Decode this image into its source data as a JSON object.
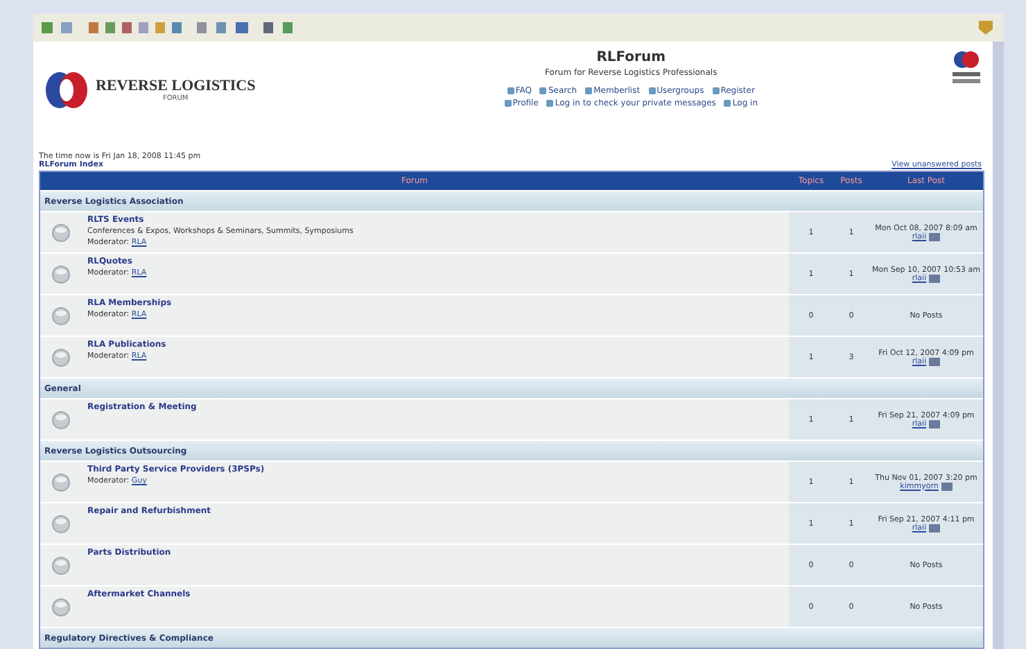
{
  "header": {
    "logo_text": "REVERSE LOGISTICS",
    "logo_sub": "FORUM",
    "title": "RLForum",
    "subtitle": "Forum for Reverse Logistics Professionals",
    "nav_row_1": [
      "FAQ",
      "Search",
      "Memberlist",
      "Usergroups",
      "Register"
    ],
    "nav_row_2": [
      "Profile",
      "Log in to check your private messages",
      "Log in"
    ]
  },
  "time_text": "The time now is Fri Jan 18, 2008 11:45 pm",
  "index_link": "RLForum Index",
  "unanswered_link": "View unanswered posts",
  "table": {
    "columns": [
      "Forum",
      "Topics",
      "Posts",
      "Last Post"
    ],
    "categories": [
      {
        "name": "Reverse Logistics Association",
        "forums": [
          {
            "name": "RLTS Events",
            "description": "Conferences & Expos, Workshops & Seminars, Summits, Symposiums",
            "moderator_label": "Moderator:",
            "moderator": "RLA",
            "topics": "1",
            "posts": "1",
            "last_post": "Mon Oct 08, 2007 8:09 am",
            "last_user": "rlaii"
          },
          {
            "name": "RLQuotes",
            "moderator_label": "Moderator:",
            "moderator": "RLA",
            "topics": "1",
            "posts": "1",
            "last_post": "Mon Sep 10, 2007 10:53 am",
            "last_user": "rlaii"
          },
          {
            "name": "RLA Memberships",
            "moderator_label": "Moderator:",
            "moderator": "RLA",
            "topics": "0",
            "posts": "0",
            "last_post": "No Posts"
          },
          {
            "name": "RLA Publications",
            "moderator_label": "Moderator:",
            "moderator": "RLA",
            "topics": "1",
            "posts": "3",
            "last_post": "Fri Oct 12, 2007 4:09 pm",
            "last_user": "rlaii"
          }
        ]
      },
      {
        "name": "General",
        "forums": [
          {
            "name": "Registration & Meeting",
            "topics": "1",
            "posts": "1",
            "last_post": "Fri Sep 21, 2007 4:09 pm",
            "last_user": "rlaii"
          }
        ]
      },
      {
        "name": "Reverse Logistics Outsourcing",
        "forums": [
          {
            "name": "Third Party Service Providers (3PSPs)",
            "moderator_label": "Moderator:",
            "moderator": "Guy",
            "topics": "1",
            "posts": "1",
            "last_post": "Thu Nov 01, 2007 3:20 pm",
            "last_user": "kimmyorn"
          },
          {
            "name": "Repair and Refurbishment",
            "topics": "1",
            "posts": "1",
            "last_post": "Fri Sep 21, 2007 4:11 pm",
            "last_user": "rlaii"
          },
          {
            "name": "Parts Distribution",
            "topics": "0",
            "posts": "0",
            "last_post": "No Posts"
          },
          {
            "name": "Aftermarket Channels",
            "topics": "0",
            "posts": "0",
            "last_post": "No Posts"
          }
        ]
      },
      {
        "name": "Regulatory Directives & Compliance"
      }
    ]
  }
}
